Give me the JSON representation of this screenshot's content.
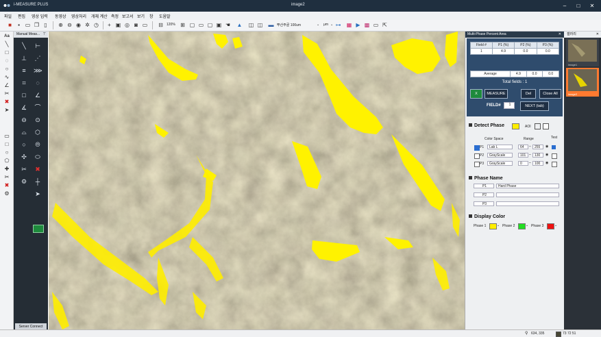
{
  "window": {
    "app_title": "i-MEASURE PLUS",
    "doc_title": "image2"
  },
  "menu": [
    "파일",
    "편집",
    "영상 입력",
    "동영상",
    "영상처리",
    "개체 계산",
    "측정",
    "보고서",
    "보기",
    "창",
    "도움말"
  ],
  "toolbar": {
    "zoom": "120%",
    "calib": "뿌산주골 100um",
    "unit": "μm"
  },
  "manual_panel": {
    "title": "Manual Meas...",
    "server_button": "Server Connect"
  },
  "right_panel": {
    "title": "Multi-Phase Percent Area",
    "headers": [
      "Field #",
      "P1 (%)",
      "P2 (%)",
      "P3 (%)"
    ],
    "row1": [
      "1",
      "4.9",
      "0.0",
      "0.0"
    ],
    "average": [
      "Average",
      "4.9",
      "0.0",
      "0.0"
    ],
    "total_fields": "Total fields : 1",
    "buttons": {
      "measure": "MEASURE",
      "del": "Del",
      "close_all": "Close All",
      "next": "NEXT (tab)"
    },
    "field_label": "FIELD#",
    "field_value": "1",
    "detect_phase": "Detect Phase",
    "aoi": "AOI",
    "color_space": "Color Space",
    "range_label": "Range",
    "test_label": "Test",
    "phases": [
      {
        "id": "P1",
        "space": "Lab L",
        "min": "64",
        "max": "255"
      },
      {
        "id": "P2",
        "space": "GrayScale",
        "min": "101",
        "max": "130"
      },
      {
        "id": "P3",
        "space": "GrayScale",
        "min": "0",
        "max": "100"
      }
    ],
    "phase_name": "Phase Name",
    "names": [
      {
        "id": "P1",
        "value": "Hard Phase"
      },
      {
        "id": "P2",
        "value": ""
      },
      {
        "id": "P3",
        "value": ""
      }
    ],
    "display_color": "Display Color",
    "colors": [
      {
        "label": "Phase 1",
        "hex": "#ffee00"
      },
      {
        "label": "Phase 2",
        "hex": "#22dd22"
      },
      {
        "label": "Phase 3",
        "hex": "#ee1111"
      }
    ]
  },
  "gallery": {
    "title": "갤러리",
    "items": [
      "image1",
      "image2"
    ]
  },
  "status": {
    "coords": "634, 335",
    "rgb": "73 72 51"
  },
  "colors": {
    "accent": "#ff7a30",
    "highlight": "#ffee00",
    "panel_dark": "#2f4c6d"
  }
}
